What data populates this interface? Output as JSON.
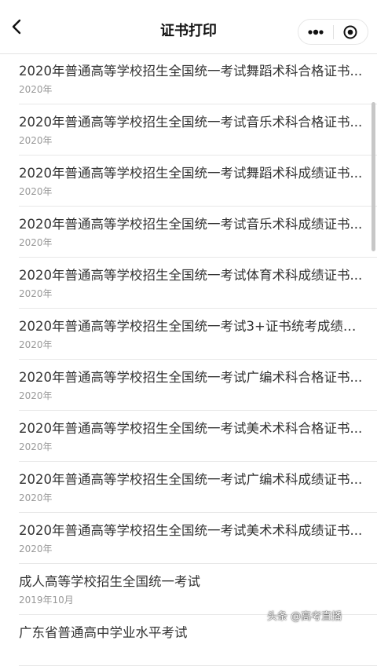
{
  "navbar": {
    "title": "证书打印",
    "back_icon": "chevron-left-icon",
    "more_icon": "more-dots-icon",
    "close_icon": "target-close-icon"
  },
  "list": {
    "items": [
      {
        "title": "2020年普通高等学校招生全国统一考试舞蹈术科合格证书...",
        "date": "2020年"
      },
      {
        "title": "2020年普通高等学校招生全国统一考试音乐术科合格证书...",
        "date": "2020年"
      },
      {
        "title": "2020年普通高等学校招生全国统一考试舞蹈术科成绩证书...",
        "date": "2020年"
      },
      {
        "title": "2020年普通高等学校招生全国统一考试音乐术科成绩证书...",
        "date": "2020年"
      },
      {
        "title": "2020年普通高等学校招生全国统一考试体育术科成绩证书...",
        "date": "2020年"
      },
      {
        "title": "2020年普通高等学校招生全国统一考试3+证书统考成绩证...",
        "date": "2020年"
      },
      {
        "title": "2020年普通高等学校招生全国统一考试广编术科合格证书...",
        "date": "2020年"
      },
      {
        "title": "2020年普通高等学校招生全国统一考试美术术科合格证书...",
        "date": "2020年"
      },
      {
        "title": "2020年普通高等学校招生全国统一考试广编术科成绩证书...",
        "date": "2020年"
      },
      {
        "title": "2020年普通高等学校招生全国统一考试美术术科成绩证书...",
        "date": "2020年"
      },
      {
        "title": "成人高等学校招生全国统一考试",
        "date": "2019年10月"
      },
      {
        "title": "广东省普通高中学业水平考试",
        "date": ""
      }
    ]
  },
  "watermark": {
    "text": "头条 @高考直播"
  },
  "colors": {
    "title_text": "#333333",
    "date_text": "#999999",
    "divider": "#e8e8e8"
  }
}
